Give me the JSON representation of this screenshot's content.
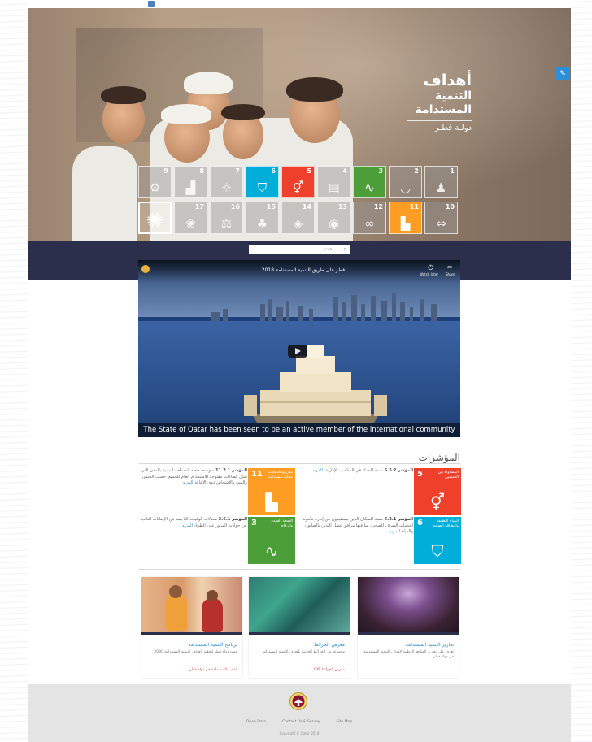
{
  "brand": {
    "line1": "أهداف",
    "line2": "التنمية",
    "line3": "المستدامة",
    "line4": "دولـة قطـر"
  },
  "search": {
    "placeholder": "بحث..."
  },
  "sdg_tiles": [
    {
      "num": "9",
      "icon": "industry-icon",
      "color": "#f36d25",
      "active": false
    },
    {
      "num": "8",
      "icon": "growth-chart-icon",
      "color": "#8f1838",
      "active": false
    },
    {
      "num": "7",
      "icon": "sun-energy-icon",
      "color": "#fdb713",
      "active": false
    },
    {
      "num": "6",
      "icon": "water-glass-icon",
      "color": "#00aed9",
      "active": true
    },
    {
      "num": "5",
      "icon": "gender-equality-icon",
      "color": "#ef402b",
      "active": true
    },
    {
      "num": "4",
      "icon": "book-icon",
      "color": "#c22033",
      "active": false
    },
    {
      "num": "3",
      "icon": "heartbeat-icon",
      "color": "#4c9f38",
      "active": true
    },
    {
      "num": "2",
      "icon": "bowl-icon",
      "color": "#d3a029",
      "active": false
    },
    {
      "num": "1",
      "icon": "people-icon",
      "color": "#e5243b",
      "active": false
    },
    {
      "num": "",
      "icon": "sdg-wheel-icon",
      "color": "#ffffff",
      "active": false
    },
    {
      "num": "17",
      "icon": "partnership-flower-icon",
      "color": "#19486a",
      "active": false
    },
    {
      "num": "16",
      "icon": "dove-gavel-icon",
      "color": "#00689d",
      "active": false
    },
    {
      "num": "15",
      "icon": "tree-bird-icon",
      "color": "#56c02b",
      "active": false
    },
    {
      "num": "14",
      "icon": "fish-icon",
      "color": "#0a97d9",
      "active": false
    },
    {
      "num": "13",
      "icon": "eye-earth-icon",
      "color": "#3f7e44",
      "active": false
    },
    {
      "num": "12",
      "icon": "infinity-icon",
      "color": "#bf8b2e",
      "active": false
    },
    {
      "num": "11",
      "icon": "city-buildings-icon",
      "color": "#fd9d24",
      "active": true
    },
    {
      "num": "10",
      "icon": "reduced-inequality-icon",
      "color": "#dd1367",
      "active": false
    }
  ],
  "video": {
    "title": "قطر على طريق التنمية المستدامة 2018",
    "watch_later": "Watch later",
    "share": "Share",
    "caption": "The State of Qatar has been seen to be an active member of the international community"
  },
  "indicators": {
    "title": "المؤشرات",
    "items": [
      {
        "goal_num": "5",
        "goal_name": "المساواة بين الجنسين",
        "color": "#ef402b",
        "icon": "gender-equality-icon",
        "code": "المؤشر 5.5.2",
        "text": "نسبة النساء في المناصب الإدارية.",
        "more": "المزيد"
      },
      {
        "goal_num": "11",
        "goal_name": "مدن ومجتمعات محلية مستدامة",
        "color": "#fd9d24",
        "icon": "city-buildings-icon",
        "code": "المؤشر 11.2.1",
        "text": "متوسط حصة المساحة المبنية بالمدن التي تمثل فضاءات مفتوحة للاستخدام العام للجميع، حسب الجنس والسن والأشخاص ذوي الإعاقة",
        "more": "المزيد"
      },
      {
        "goal_num": "6",
        "goal_name": "المياه النظيفة والنظافة الصحية",
        "color": "#00aed9",
        "icon": "water-glass-icon",
        "code": "المؤشر 6.2.1",
        "text": "نسبة السكان الذين يستفيدون من إدارة مأمونة لخدمات الصرف الصحي، بما فيها مرافق غسل اليدين بالصابون والمياه",
        "more": "المزيد"
      },
      {
        "goal_num": "3",
        "goal_name": "الصحة الجيدة والرفاه",
        "color": "#4c9f38",
        "icon": "heartbeat-icon",
        "code": "المؤشر 3.6.1",
        "text": "معدلات الوفيات الناجمة عن الإصابات الناتجة عن حوادث المرور على الطرق",
        "more": "المزيد"
      }
    ]
  },
  "news": [
    {
      "title": "تقارير التنمية المستدامة",
      "desc": "تعرف على تقارير المتابعة الوطنية لأهداف التنمية المستدامة في دولة قطر",
      "link": "",
      "theme": "hall"
    },
    {
      "title": "معرض الخرائط",
      "desc": "مجموعة من الخرائط الخاصة بأهداف التنمية المستدامة",
      "link": "معرض الخرائط GIS",
      "theme": "map"
    },
    {
      "title": "برنامج التنمية المستدامة",
      "desc": "جهود دولة قطر لتحقيق أهداف التنمية المستدامة 2030",
      "link": "التنمية المستدامة في دولة قطر",
      "theme": "kids"
    }
  ],
  "footer": {
    "links": [
      "Open Data",
      "Contact Us & Survey",
      "Site Map"
    ],
    "copyright": "Copyright © Qatar 2018"
  }
}
